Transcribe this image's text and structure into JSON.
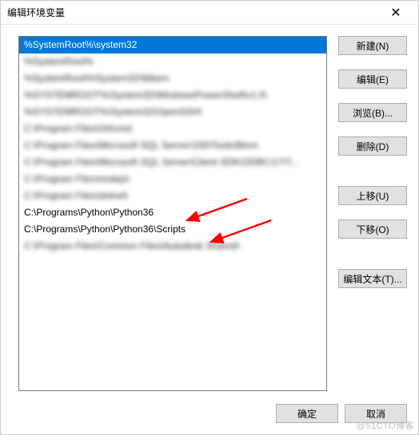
{
  "title": "编辑环境变量",
  "close_glyph": "✕",
  "list": [
    {
      "text": "%SystemRoot%\\system32",
      "selected": true,
      "blur": false
    },
    {
      "text": "%SystemRoot%",
      "selected": false,
      "blur": true
    },
    {
      "text": "%SystemRoot%\\System32\\Wbem",
      "selected": false,
      "blur": true
    },
    {
      "text": "%SYSTEMROOT%\\System32\\WindowsPowerShell\\v1.0\\",
      "selected": false,
      "blur": true
    },
    {
      "text": "%SYSTEMROOT%\\System32\\OpenSSH\\",
      "selected": false,
      "blur": true
    },
    {
      "text": "C:\\Program Files\\Git\\cmd",
      "selected": false,
      "blur": true
    },
    {
      "text": "C:\\Program Files\\Microsoft SQL Server\\150\\Tools\\Binn\\",
      "selected": false,
      "blur": true
    },
    {
      "text": "C:\\Program Files\\Microsoft SQL Server\\Client SDK\\ODBC\\17\\T...",
      "selected": false,
      "blur": true
    },
    {
      "text": "C:\\Program Files\\nodejs\\",
      "selected": false,
      "blur": true
    },
    {
      "text": "C:\\Program Files\\dotnet\\",
      "selected": false,
      "blur": true
    },
    {
      "text": "C:\\Programs\\Python\\Python36",
      "selected": false,
      "blur": false
    },
    {
      "text": "C:\\Programs\\Python\\Python36\\Scripts",
      "selected": false,
      "blur": false
    },
    {
      "text": "C:\\Program Files\\Common Files\\Autodesk Shared\\",
      "selected": false,
      "blur": true
    }
  ],
  "buttons": {
    "new": "新建(N)",
    "edit": "编辑(E)",
    "browse": "浏览(B)...",
    "delete": "删除(D)",
    "up": "上移(U)",
    "down": "下移(O)",
    "edit_text": "编辑文本(T)..."
  },
  "footer": {
    "ok": "确定",
    "cancel": "取消"
  },
  "watermark": "@51CTO博客"
}
